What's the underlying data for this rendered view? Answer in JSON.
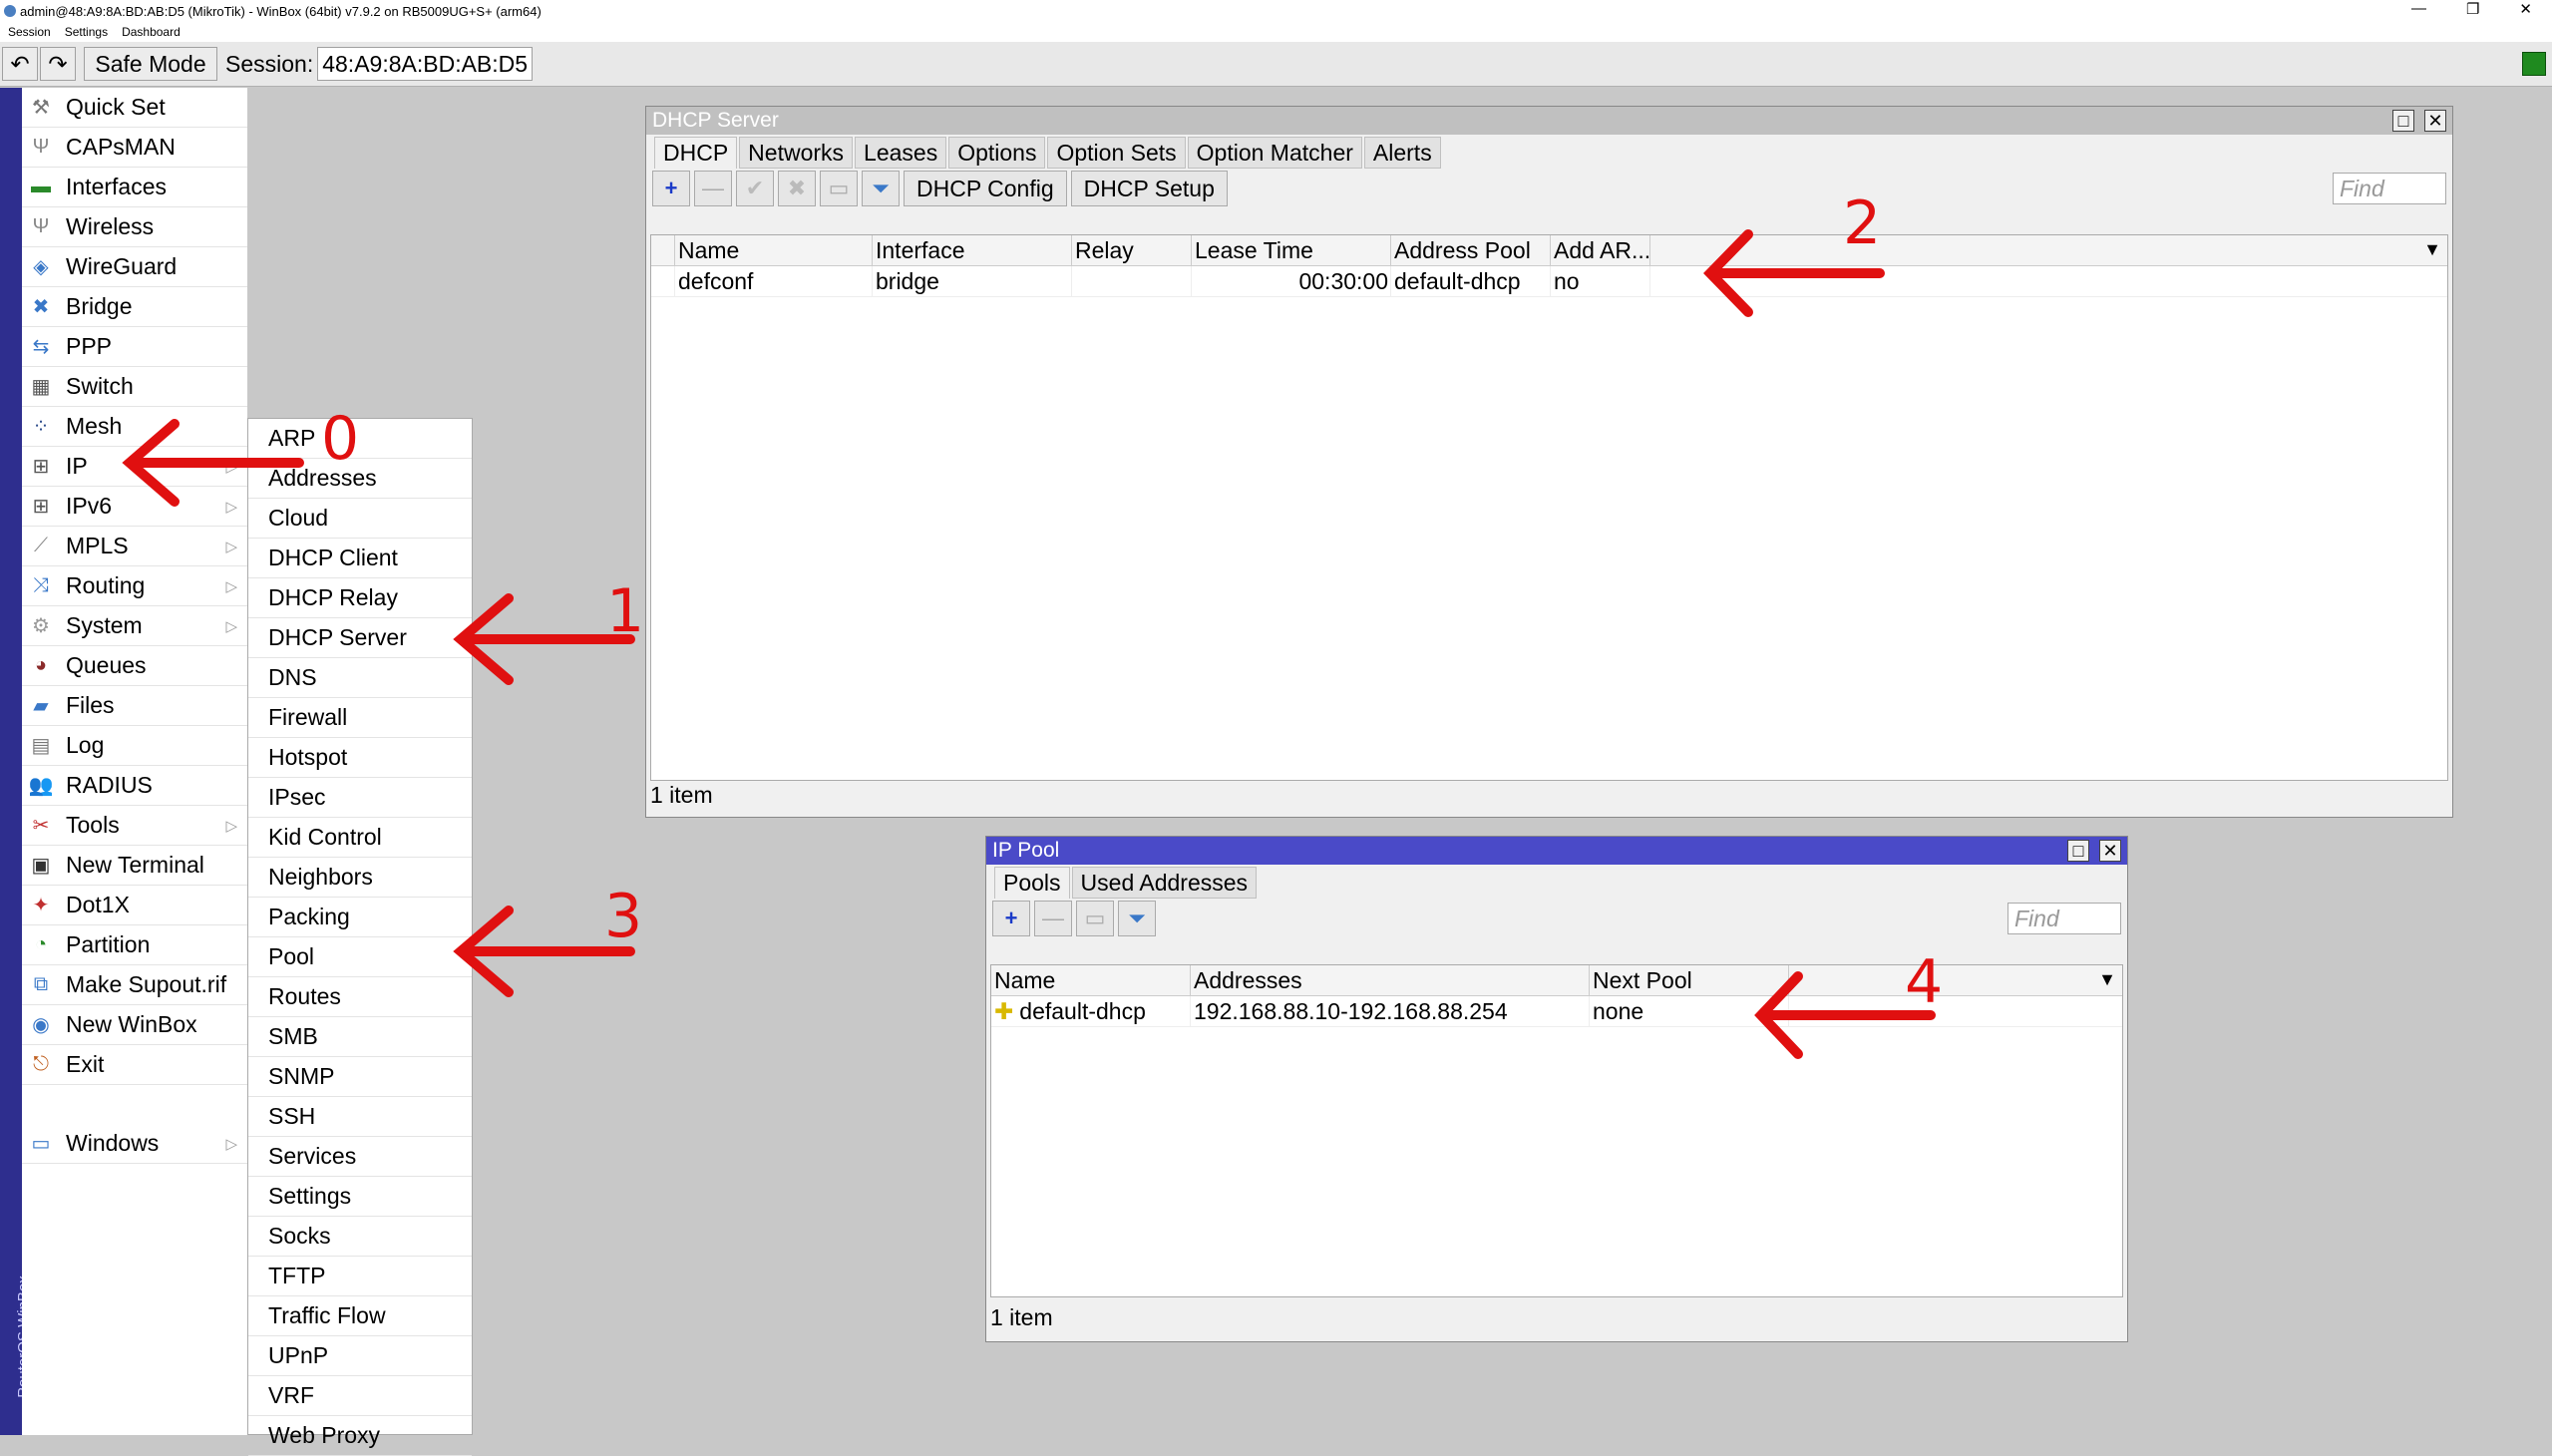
{
  "app": {
    "title": "admin@48:A9:8A:BD:AB:D5 (MikroTik) - WinBox (64bit) v7.9.2 on RB5009UG+S+ (arm64)",
    "menu": [
      "Session",
      "Settings",
      "Dashboard"
    ],
    "safe_mode": "Safe Mode",
    "session_label": "Session:",
    "session_value": "48:A9:8A:BD:AB:D5",
    "side_label": "RouterOS WinBox"
  },
  "sidebar": {
    "items": [
      {
        "label": "Quick Set",
        "icon": "wand-icon",
        "glyph": "⚒",
        "color": "#777"
      },
      {
        "label": "CAPsMAN",
        "icon": "antenna-icon",
        "glyph": "Ψ",
        "color": "#888"
      },
      {
        "label": "Interfaces",
        "icon": "interfaces-icon",
        "glyph": "▬",
        "color": "#2a8a2a"
      },
      {
        "label": "Wireless",
        "icon": "wireless-icon",
        "glyph": "Ψ",
        "color": "#888"
      },
      {
        "label": "WireGuard",
        "icon": "wireguard-icon",
        "glyph": "◈",
        "color": "#3a78c8"
      },
      {
        "label": "Bridge",
        "icon": "bridge-icon",
        "glyph": "✖",
        "color": "#3a78c8"
      },
      {
        "label": "PPP",
        "icon": "ppp-icon",
        "glyph": "⇆",
        "color": "#3a78c8"
      },
      {
        "label": "Switch",
        "icon": "switch-icon",
        "glyph": "▦",
        "color": "#555"
      },
      {
        "label": "Mesh",
        "icon": "mesh-icon",
        "glyph": "⁘",
        "color": "#2a4a8a"
      },
      {
        "label": "IP",
        "icon": "ip-icon",
        "glyph": "⊞",
        "color": "#555",
        "arrow": true
      },
      {
        "label": "IPv6",
        "icon": "ipv6-icon",
        "glyph": "⊞",
        "color": "#555",
        "arrow": true
      },
      {
        "label": "MPLS",
        "icon": "mpls-icon",
        "glyph": "⟋",
        "color": "#888",
        "arrow": true
      },
      {
        "label": "Routing",
        "icon": "routing-icon",
        "glyph": "⤨",
        "color": "#3a78c8",
        "arrow": true
      },
      {
        "label": "System",
        "icon": "system-icon",
        "glyph": "⚙",
        "color": "#999",
        "arrow": true
      },
      {
        "label": "Queues",
        "icon": "queues-icon",
        "glyph": "◕",
        "color": "#8a2a2a"
      },
      {
        "label": "Files",
        "icon": "files-icon",
        "glyph": "▰",
        "color": "#3a78c8"
      },
      {
        "label": "Log",
        "icon": "log-icon",
        "glyph": "▤",
        "color": "#777"
      },
      {
        "label": "RADIUS",
        "icon": "radius-icon",
        "glyph": "👥",
        "color": "#3a78c8"
      },
      {
        "label": "Tools",
        "icon": "tools-icon",
        "glyph": "✂",
        "color": "#c03030",
        "arrow": true
      },
      {
        "label": "New Terminal",
        "icon": "terminal-icon",
        "glyph": "▣",
        "color": "#333"
      },
      {
        "label": "Dot1X",
        "icon": "dot1x-icon",
        "glyph": "✦",
        "color": "#c03030"
      },
      {
        "label": "Partition",
        "icon": "partition-icon",
        "glyph": "◔",
        "color": "#2a8a2a"
      },
      {
        "label": "Make Supout.rif",
        "icon": "supout-icon",
        "glyph": "⧉",
        "color": "#3a78c8"
      },
      {
        "label": "New WinBox",
        "icon": "winbox-icon",
        "glyph": "◉",
        "color": "#3a78c8"
      },
      {
        "label": "Exit",
        "icon": "exit-icon",
        "glyph": "⎋",
        "color": "#c06020"
      },
      {
        "label": "",
        "icon": "",
        "glyph": "",
        "color": "#fff"
      },
      {
        "label": "Windows",
        "icon": "windows-icon",
        "glyph": "▭",
        "color": "#3a78c8",
        "arrow": true
      }
    ]
  },
  "ip_submenu": {
    "items": [
      "ARP",
      "Addresses",
      "Cloud",
      "DHCP Client",
      "DHCP Relay",
      "DHCP Server",
      "DNS",
      "Firewall",
      "Hotspot",
      "IPsec",
      "Kid Control",
      "Neighbors",
      "Packing",
      "Pool",
      "Routes",
      "SMB",
      "SNMP",
      "SSH",
      "Services",
      "Settings",
      "Socks",
      "TFTP",
      "Traffic Flow",
      "UPnP",
      "VRF",
      "Web Proxy"
    ]
  },
  "dhcp_window": {
    "title": "DHCP Server",
    "tabs": [
      "DHCP",
      "Networks",
      "Leases",
      "Options",
      "Option Sets",
      "Option Matcher",
      "Alerts"
    ],
    "buttons": {
      "config": "DHCP Config",
      "setup": "DHCP Setup"
    },
    "find_placeholder": "Find",
    "columns": [
      "Name",
      "Interface",
      "Relay",
      "Lease Time",
      "Address Pool",
      "Add AR..."
    ],
    "rows": [
      {
        "name": "defconf",
        "interface": "bridge",
        "relay": "",
        "lease_time": "00:30:00",
        "address_pool": "default-dhcp",
        "add_arp": "no"
      }
    ],
    "status": "1 item"
  },
  "pool_window": {
    "title": "IP Pool",
    "tabs": [
      "Pools",
      "Used Addresses"
    ],
    "find_placeholder": "Find",
    "columns": [
      "Name",
      "Addresses",
      "Next Pool"
    ],
    "rows": [
      {
        "name": "default-dhcp",
        "addresses": "192.168.88.10-192.168.88.254",
        "next_pool": "none"
      }
    ],
    "status": "1 item"
  },
  "annotations": [
    "0",
    "1",
    "2",
    "3",
    "4"
  ],
  "colors": {
    "annotation": "#e01010",
    "pool_title": "#4a4ac8",
    "dhcp_title": "#c0c0c0",
    "accent": "#2e2e8e"
  }
}
